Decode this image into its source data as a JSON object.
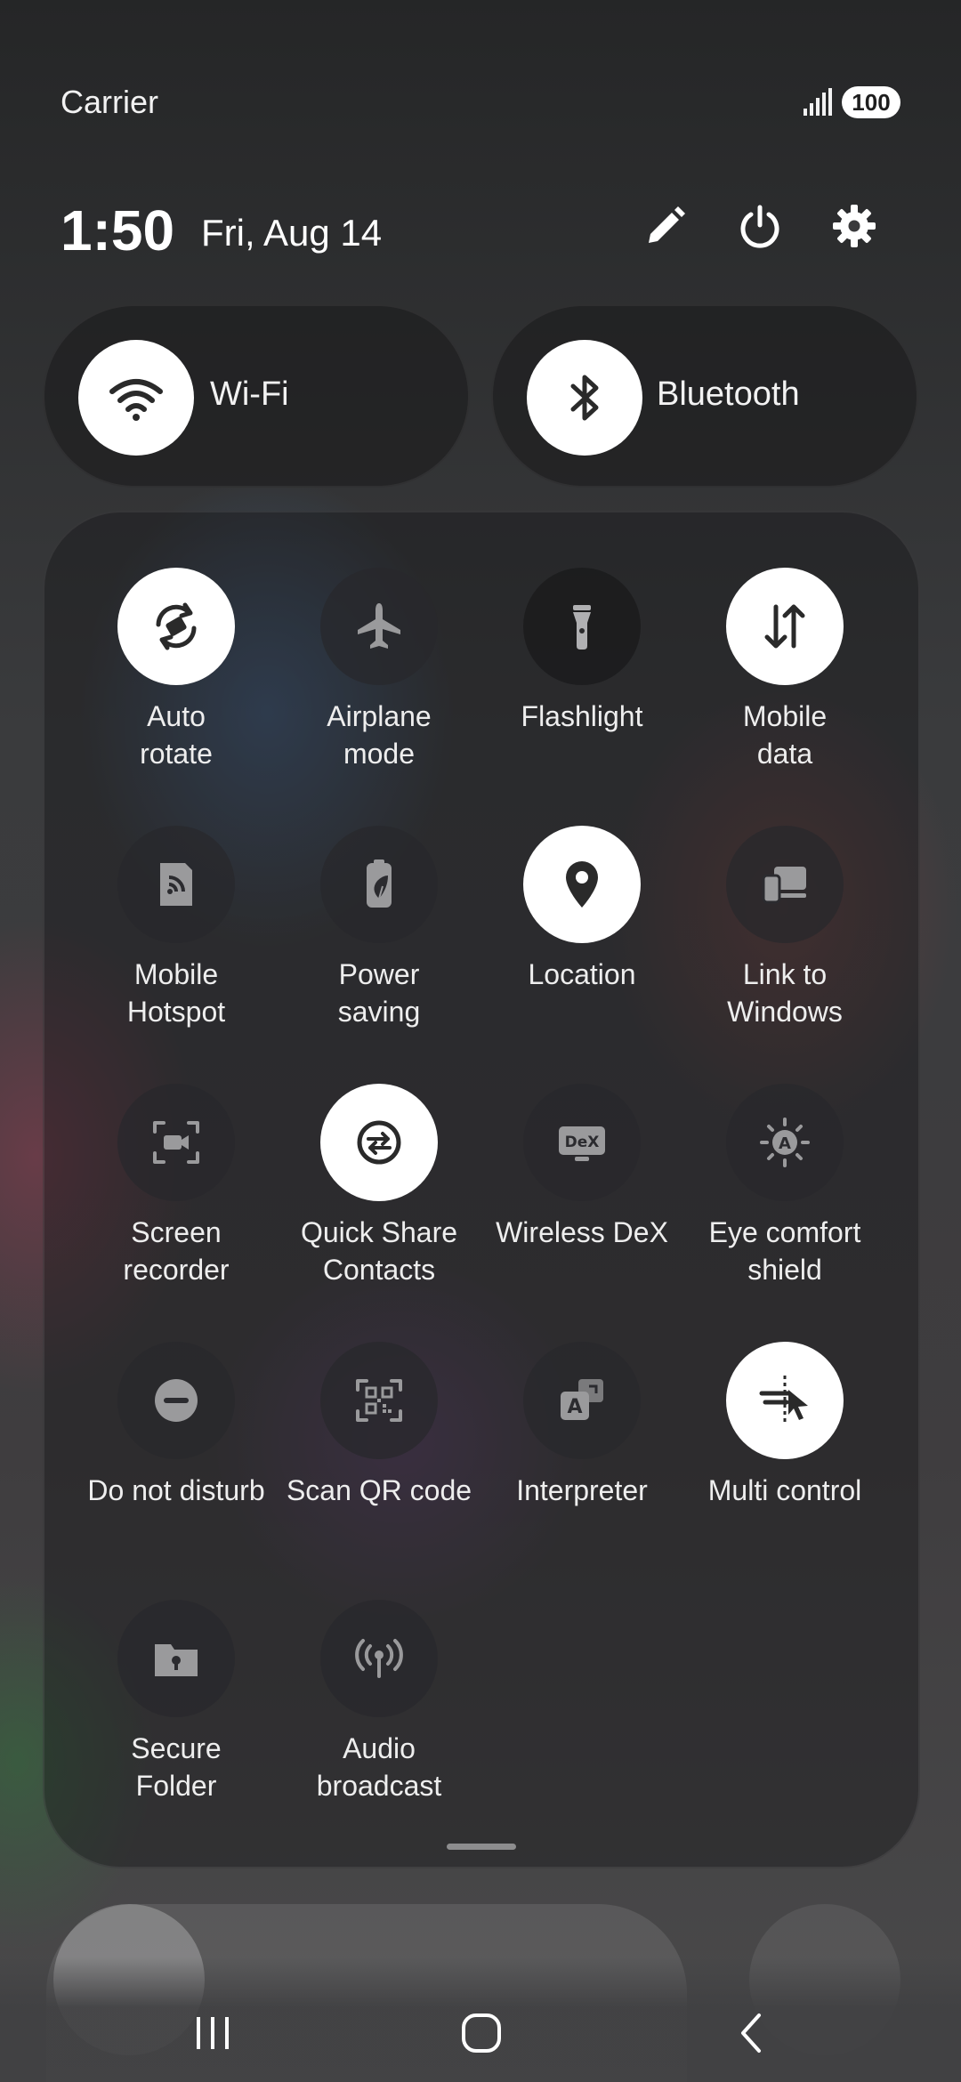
{
  "status_bar": {
    "carrier": "Carrier",
    "signal_icon": "signal-bars-icon",
    "battery": "100"
  },
  "header": {
    "time": "1:50",
    "date": "Fri, Aug 14",
    "edit_icon": "pencil-icon",
    "power_icon": "power-icon",
    "settings_icon": "gear-icon"
  },
  "toggles": [
    {
      "label": "Wi-Fi",
      "icon": "wifi-icon",
      "active": true
    },
    {
      "label": "Bluetooth",
      "icon": "bluetooth-icon",
      "active": true
    }
  ],
  "tiles": [
    {
      "label": "Auto\nrotate",
      "icon": "auto-rotate-icon",
      "active": true
    },
    {
      "label": "Airplane\nmode",
      "icon": "airplane-icon",
      "active": false
    },
    {
      "label": "Flashlight",
      "icon": "flashlight-icon",
      "active": false
    },
    {
      "label": "Mobile\ndata",
      "icon": "mobile-data-icon",
      "active": true
    },
    {
      "label": "Mobile\nHotspot",
      "icon": "hotspot-icon",
      "active": false
    },
    {
      "label": "Power\nsaving",
      "icon": "power-saving-icon",
      "active": false
    },
    {
      "label": "Location",
      "icon": "location-icon",
      "active": true
    },
    {
      "label": "Link to\nWindows",
      "icon": "link-to-windows-icon",
      "active": false
    },
    {
      "label": "Screen\nrecorder",
      "icon": "screen-recorder-icon",
      "active": false
    },
    {
      "label": "Quick Share\nContacts",
      "icon": "quick-share-icon",
      "active": true
    },
    {
      "label": "Wireless DeX",
      "icon": "dex-icon",
      "active": false
    },
    {
      "label": "Eye comfort\nshield",
      "icon": "eye-comfort-icon",
      "active": false
    },
    {
      "label": "Do not disturb",
      "icon": "do-not-disturb-icon",
      "active": false
    },
    {
      "label": "Scan QR code",
      "icon": "qr-code-icon",
      "active": false
    },
    {
      "label": "Interpreter",
      "icon": "interpreter-icon",
      "active": false
    },
    {
      "label": "Multi control",
      "icon": "multi-control-icon",
      "active": true
    },
    {
      "label": "Secure\nFolder",
      "icon": "secure-folder-icon",
      "active": false
    },
    {
      "label": "Audio\nbroadcast",
      "icon": "audio-broadcast-icon",
      "active": false
    }
  ],
  "navigation": {
    "recents_icon": "recents-icon",
    "home_icon": "home-icon",
    "back_icon": "back-icon"
  },
  "colors": {
    "active_tile": "#ffffff",
    "inactive_tile": "#2b2b2f",
    "active_icon": "#2a2a2a",
    "inactive_icon": "#9a9a9c"
  }
}
